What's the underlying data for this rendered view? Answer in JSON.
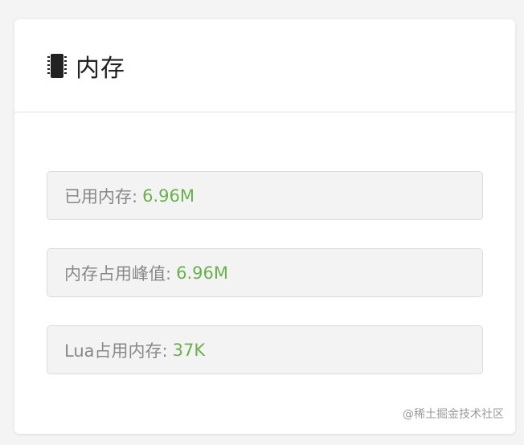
{
  "panel": {
    "title": "内存",
    "icon": "memory-chip-icon"
  },
  "stats": [
    {
      "label": "已用内存:",
      "value": "6.96M"
    },
    {
      "label": "内存占用峰值:",
      "value": "6.96M"
    },
    {
      "label": "Lua占用内存:",
      "value": "37K"
    }
  ],
  "colors": {
    "value": "#6ab04c",
    "label": "#888888",
    "title": "#222222"
  },
  "watermark": "@稀土掘金技术社区"
}
